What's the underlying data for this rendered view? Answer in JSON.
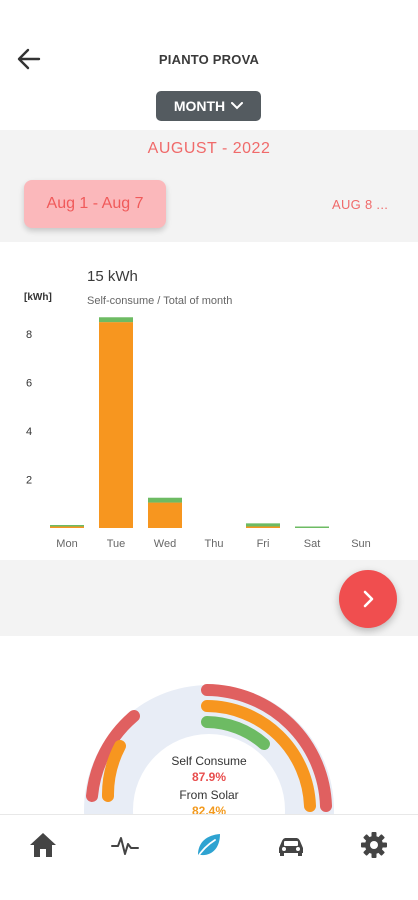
{
  "header": {
    "title": "PIANTO PROVA",
    "back_icon": "arrow-left-icon",
    "period_selector": "MONTH"
  },
  "period": {
    "month_label": "AUGUST - 2022",
    "active_week": "Aug 1 - Aug 7",
    "next_week": "AUG 8 ..."
  },
  "chart_data": {
    "type": "bar",
    "title": "15 kWh",
    "subtitle": "Self-consume / Total of month",
    "ylabel": "[kWh]",
    "categories": [
      "Mon",
      "Tue",
      "Wed",
      "Thu",
      "Fri",
      "Sat",
      "Sun"
    ],
    "yticks": [
      "2",
      "4",
      "6",
      "8"
    ],
    "ylim": [
      0,
      9
    ],
    "stacked": true,
    "series": [
      {
        "color": "#f7961f",
        "values": [
          0.05,
          8.5,
          1.05,
          0,
          0.02,
          0,
          0
        ]
      },
      {
        "color": "#6dbb63",
        "values": [
          0.03,
          0.2,
          0.2,
          0,
          0.13,
          0.05,
          0
        ]
      }
    ],
    "grid": false
  },
  "donut": {
    "label1": "Self Consume",
    "value1": "87.9%",
    "label2": "From Solar",
    "value2": "82.4%"
  },
  "tabs": [
    {
      "icon": "home-icon",
      "color": "#444444",
      "active": false
    },
    {
      "icon": "activity-pulse-icon",
      "color": "#444444",
      "active": false
    },
    {
      "icon": "leaf-icon",
      "color": "#2ea3d1",
      "active": true
    },
    {
      "icon": "car-icon",
      "color": "#444444",
      "active": false
    },
    {
      "icon": "gear-icon",
      "color": "#444444",
      "active": false
    }
  ],
  "colors": {
    "accent_red": "#f04e4f",
    "orange": "#f7961f",
    "green": "#6dbb63",
    "dark_red_ring": "#e06060"
  }
}
